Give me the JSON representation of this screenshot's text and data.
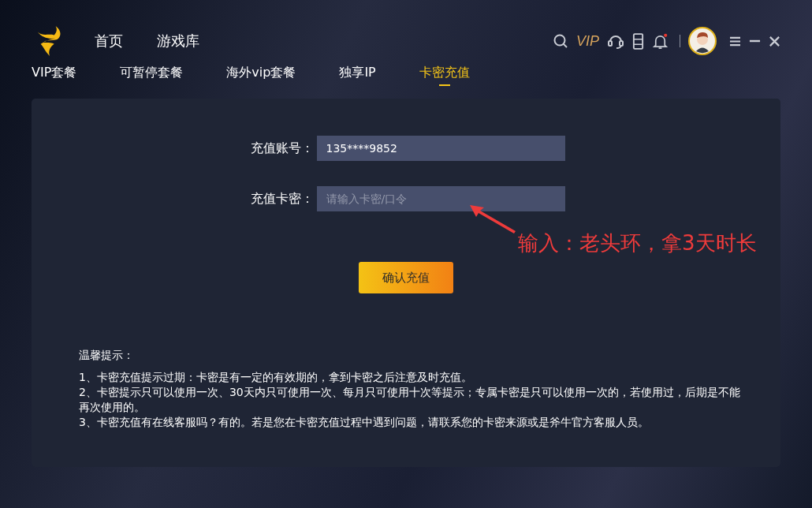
{
  "header": {
    "nav": [
      {
        "label": "首页",
        "selected": false
      },
      {
        "label": "游戏库",
        "selected": false
      }
    ],
    "vip_badge": "VIP"
  },
  "tabs": [
    {
      "label": "VIP套餐",
      "selected": false
    },
    {
      "label": "可暂停套餐",
      "selected": false
    },
    {
      "label": "海外vip套餐",
      "selected": false
    },
    {
      "label": "独享IP",
      "selected": false
    },
    {
      "label": "卡密充值",
      "selected": true
    }
  ],
  "form": {
    "fields": [
      {
        "label": "充值账号：",
        "value": "135****9852"
      },
      {
        "label": "充值卡密：",
        "placeholder": "请输入卡密/口令"
      }
    ],
    "submit": "确认充值"
  },
  "annotation": "输入：老头环，拿3天时长",
  "tips": {
    "title": "温馨提示：",
    "items": [
      "1、卡密充值提示过期：卡密是有一定的有效期的，拿到卡密之后注意及时充值。",
      "2、卡密提示只可以使用一次、30天内只可使用一次、每月只可使用十次等提示；专属卡密是只可以使用一次的，若使用过，后期是不能再次使用的。",
      "3、卡密充值有在线客服吗？有的。若是您在卡密充值过程中遇到问题，请联系您的卡密来源或是斧牛官方客服人员。"
    ]
  }
}
